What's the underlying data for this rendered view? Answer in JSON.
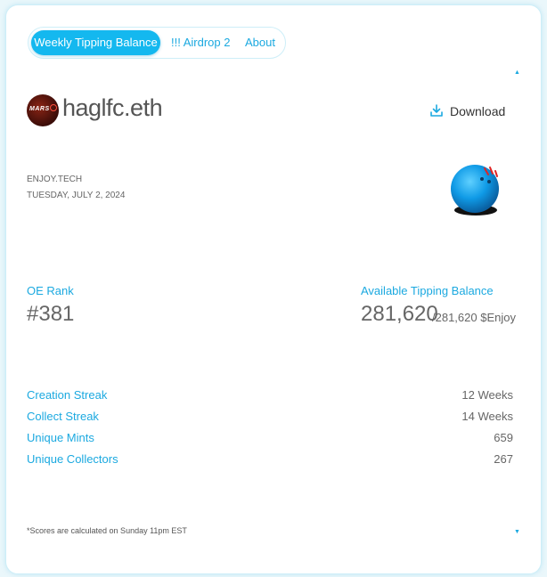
{
  "tabs": [
    {
      "label": "Weekly Tipping Balance",
      "active": true
    },
    {
      "label": "!!! Airdrop 2",
      "active": false
    },
    {
      "label": "About",
      "active": false
    }
  ],
  "profile": {
    "username": "haglfc.eth",
    "avatar_text": "MARS",
    "platform": "ENJOY.TECH",
    "date": "TUESDAY, JULY 2, 2024"
  },
  "download": {
    "label": "Download"
  },
  "oe_rank": {
    "label": "OE Rank",
    "value": "#381"
  },
  "tipping_balance": {
    "label": "Available Tipping Balance",
    "value": "281,620",
    "total": "/281,620 $Enjoy"
  },
  "stats": [
    {
      "label": "Creation Streak",
      "value": "12 Weeks"
    },
    {
      "label": "Collect Streak",
      "value": "14 Weeks"
    },
    {
      "label": "Unique Mints",
      "value": "659"
    },
    {
      "label": "Unique Collectors",
      "value": "267"
    }
  ],
  "footnote": "*Scores are calculated on Sunday 11pm EST",
  "colors": {
    "accent": "#14b8ef",
    "link_text": "#1ba9e0",
    "value_text": "#666666",
    "background": "#eaf7fb"
  },
  "icons": {
    "scroll_up": "caret-up-icon",
    "scroll_down": "caret-down-icon",
    "download": "download-icon",
    "mascot": "blue-ball-mascot"
  }
}
